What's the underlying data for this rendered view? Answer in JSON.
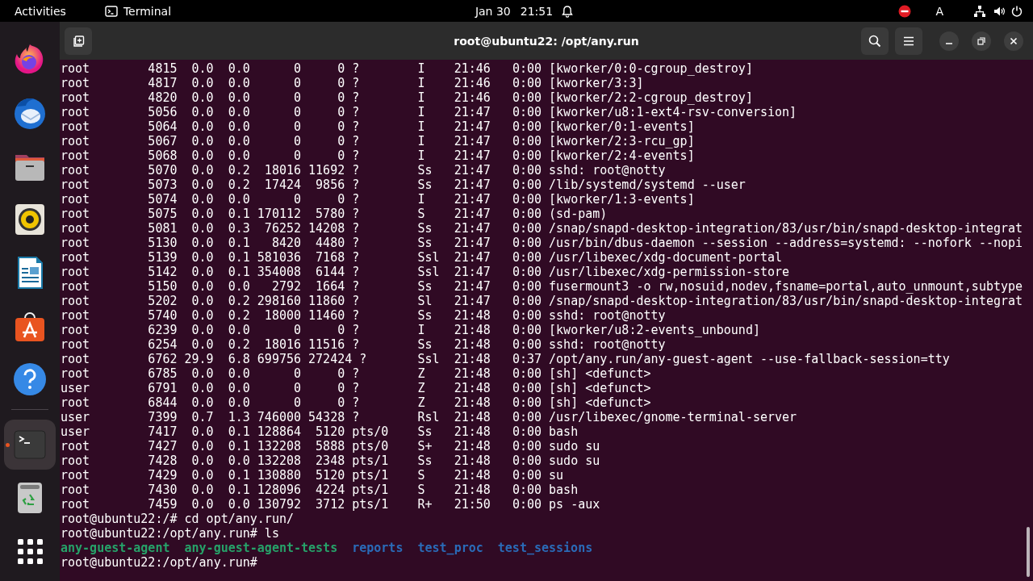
{
  "top_bar": {
    "activities": "Activities",
    "app_name": "Terminal",
    "date": "Jan 30",
    "time": "21:51",
    "input_source": "A"
  },
  "dock": {
    "items": [
      {
        "kind": "firefox"
      },
      {
        "kind": "mail"
      },
      {
        "kind": "files"
      },
      {
        "kind": "music"
      },
      {
        "kind": "writer"
      },
      {
        "kind": "store"
      },
      {
        "kind": "help"
      },
      {
        "kind": "separator"
      },
      {
        "kind": "terminal",
        "running": true
      },
      {
        "kind": "trash"
      },
      {
        "kind": "apps"
      }
    ]
  },
  "window": {
    "title": "root@ubuntu22: /opt/any.run",
    "lines": [
      {
        "kind": "text",
        "text": "root        4815  0.0  0.0      0     0 ?        I    21:46   0:00 [kworker/0:0-cgroup_destroy]"
      },
      {
        "kind": "text",
        "text": "root        4817  0.0  0.0      0     0 ?        I    21:46   0:00 [kworker/3:3]"
      },
      {
        "kind": "text",
        "text": "root        4820  0.0  0.0      0     0 ?        I    21:46   0:00 [kworker/2:2-cgroup_destroy]"
      },
      {
        "kind": "text",
        "text": "root        5056  0.0  0.0      0     0 ?        I    21:47   0:00 [kworker/u8:1-ext4-rsv-conversion]"
      },
      {
        "kind": "text",
        "text": "root        5064  0.0  0.0      0     0 ?        I    21:47   0:00 [kworker/0:1-events]"
      },
      {
        "kind": "text",
        "text": "root        5067  0.0  0.0      0     0 ?        I    21:47   0:00 [kworker/2:3-rcu_gp]"
      },
      {
        "kind": "text",
        "text": "root        5068  0.0  0.0      0     0 ?        I    21:47   0:00 [kworker/2:4-events]"
      },
      {
        "kind": "text",
        "text": "root        5070  0.0  0.2  18016 11692 ?        Ss   21:47   0:00 sshd: root@notty"
      },
      {
        "kind": "text",
        "text": "root        5073  0.0  0.2  17424  9856 ?        Ss   21:47   0:00 /lib/systemd/systemd --user"
      },
      {
        "kind": "text",
        "text": "root        5074  0.0  0.0      0     0 ?        I    21:47   0:00 [kworker/1:3-events]"
      },
      {
        "kind": "text",
        "text": "root        5075  0.0  0.1 170112  5780 ?        S    21:47   0:00 (sd-pam)"
      },
      {
        "kind": "text",
        "text": "root        5081  0.0  0.3  76252 14208 ?        Ss   21:47   0:00 /snap/snapd-desktop-integration/83/usr/bin/snapd-desktop-integrat"
      },
      {
        "kind": "text",
        "text": "root        5130  0.0  0.1   8420  4480 ?        Ss   21:47   0:00 /usr/bin/dbus-daemon --session --address=systemd: --nofork --nopi"
      },
      {
        "kind": "text",
        "text": "root        5139  0.0  0.1 581036  7168 ?        Ssl  21:47   0:00 /usr/libexec/xdg-document-portal"
      },
      {
        "kind": "text",
        "text": "root        5142  0.0  0.1 354008  6144 ?        Ssl  21:47   0:00 /usr/libexec/xdg-permission-store"
      },
      {
        "kind": "text",
        "text": "root        5150  0.0  0.0   2792  1664 ?        Ss   21:47   0:00 fusermount3 -o rw,nosuid,nodev,fsname=portal,auto_unmount,subtype"
      },
      {
        "kind": "text",
        "text": "root        5202  0.0  0.2 298160 11860 ?        Sl   21:47   0:00 /snap/snapd-desktop-integration/83/usr/bin/snapd-desktop-integrat"
      },
      {
        "kind": "text",
        "text": "root        5740  0.0  0.2  18000 11460 ?        Ss   21:48   0:00 sshd: root@notty"
      },
      {
        "kind": "text",
        "text": "root        6239  0.0  0.0      0     0 ?        I    21:48   0:00 [kworker/u8:2-events_unbound]"
      },
      {
        "kind": "text",
        "text": "root        6254  0.0  0.2  18016 11516 ?        Ss   21:48   0:00 sshd: root@notty"
      },
      {
        "kind": "text",
        "text": "root        6762 29.9  6.8 699756 272424 ?       Ssl  21:48   0:37 /opt/any.run/any-guest-agent --use-fallback-session=tty"
      },
      {
        "kind": "text",
        "text": "root        6785  0.0  0.0      0     0 ?        Z    21:48   0:00 [sh] <defunct>"
      },
      {
        "kind": "text",
        "text": "user        6791  0.0  0.0      0     0 ?        Z    21:48   0:00 [sh] <defunct>"
      },
      {
        "kind": "text",
        "text": "root        6844  0.0  0.0      0     0 ?        Z    21:48   0:00 [sh] <defunct>"
      },
      {
        "kind": "text",
        "text": "user        7399  0.7  1.3 746000 54328 ?        Rsl  21:48   0:00 /usr/libexec/gnome-terminal-server"
      },
      {
        "kind": "text",
        "text": "user        7417  0.0  0.1 128864  5120 pts/0    Ss   21:48   0:00 bash"
      },
      {
        "kind": "text",
        "text": "root        7427  0.0  0.1 132208  5888 pts/0    S+   21:48   0:00 sudo su"
      },
      {
        "kind": "text",
        "text": "root        7428  0.0  0.0 132208  2348 pts/1    Ss   21:48   0:00 sudo su"
      },
      {
        "kind": "text",
        "text": "root        7429  0.0  0.1 130880  5120 pts/1    S    21:48   0:00 su"
      },
      {
        "kind": "text",
        "text": "root        7430  0.0  0.1 128096  4224 pts/1    S    21:48   0:00 bash"
      },
      {
        "kind": "text",
        "text": "root        7459  0.0  0.0 130792  3712 pts/1    R+   21:50   0:00 ps -aux"
      },
      {
        "kind": "text",
        "text": "root@ubuntu22:/# cd opt/any.run/"
      },
      {
        "kind": "text",
        "text": "root@ubuntu22:/opt/any.run# ls"
      },
      {
        "kind": "listing",
        "entries": [
          {
            "name": "any-guest-agent",
            "kind": "executable"
          },
          {
            "name": "any-guest-agent-tests",
            "kind": "executable"
          },
          {
            "name": "reports",
            "kind": "directory"
          },
          {
            "name": "test_proc",
            "kind": "directory"
          },
          {
            "name": "test_sessions",
            "kind": "directory"
          }
        ]
      },
      {
        "kind": "text",
        "text": "root@ubuntu22:/opt/any.run#"
      }
    ]
  }
}
